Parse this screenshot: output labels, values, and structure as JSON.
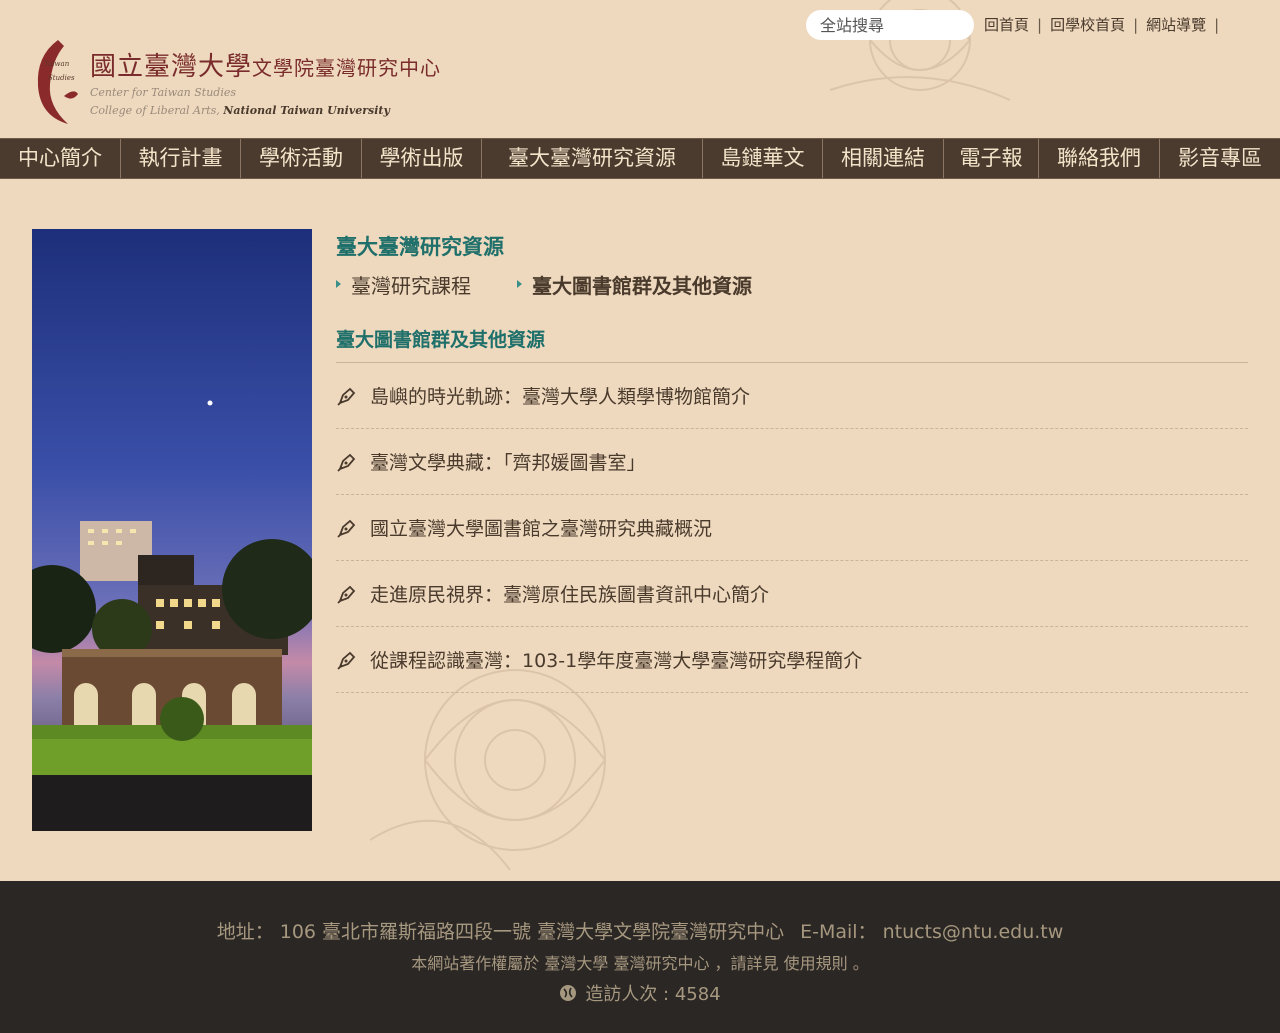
{
  "header": {
    "logo_title": "國立臺灣大學",
    "logo_subtitle": "文學院臺灣研究中心",
    "logo_mark_text": "Taiwan Studies",
    "logo_en_1": "Center for Taiwan Studies",
    "logo_en_2a": "College of Liberal Arts,",
    "logo_en_2b": "National Taiwan University",
    "search_placeholder": "全站搜尋",
    "links": [
      "回首頁",
      "回學校首頁",
      "網站導覽"
    ]
  },
  "nav": {
    "items": [
      "中心簡介",
      "執行計畫",
      "學術活動",
      "學術出版",
      "臺大臺灣研究資源",
      "島鏈華文",
      "相關連結",
      "電子報",
      "聯絡我們",
      "影音專區"
    ]
  },
  "content": {
    "section_title": "臺大臺灣研究資源",
    "subnav": [
      {
        "label": "臺灣研究課程",
        "active": false
      },
      {
        "label": "臺大圖書館群及其他資源",
        "active": true
      }
    ],
    "list_title": "臺大圖書館群及其他資源",
    "items": [
      "島嶼的時光軌跡：臺灣大學人類學博物館簡介",
      "臺灣文學典藏：「齊邦媛圖書室」",
      "國立臺灣大學圖書館之臺灣研究典藏概況",
      "走進原民視界：臺灣原住民族圖書資訊中心簡介",
      "從課程認識臺灣：103-1學年度臺灣大學臺灣研究學程簡介"
    ]
  },
  "footer": {
    "address": "地址： 106 臺北市羅斯福路四段一號 臺灣大學文學院臺灣研究中心",
    "email": "E-Mail： ntucts@ntu.edu.tw",
    "copyright": "本網站著作權屬於 臺灣大學 臺灣研究中心 ，請詳見 使用規則 。",
    "visitors": "造訪人次 : 4584"
  },
  "colors": {
    "background": "#eed9bf",
    "nav_bg": "#4b3b2f",
    "accent_teal": "#1f6f6a",
    "footer_bg": "#2a2724"
  }
}
